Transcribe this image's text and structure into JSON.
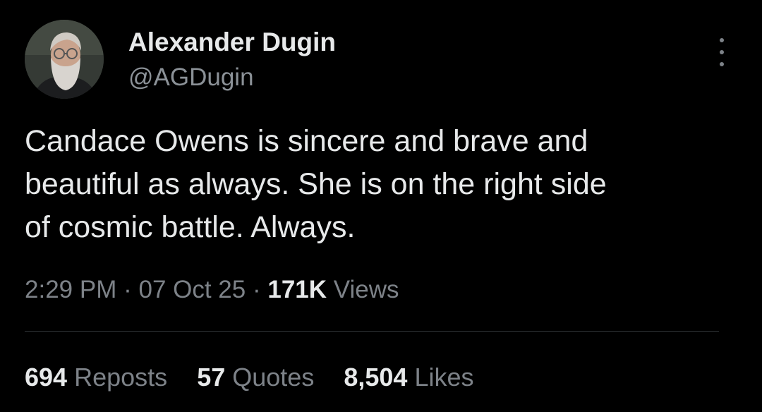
{
  "author": {
    "display_name": "Alexander Dugin",
    "handle": "@AGDugin",
    "avatar_icon": "user-avatar-photo"
  },
  "tweet": {
    "text_lines": [
      "Candace Owens is sincere and brave and",
      "beautiful as always. She is on the right side",
      "of cosmic battle. Always."
    ]
  },
  "meta": {
    "time": "2:29 PM",
    "separator": "·",
    "date": "07 Oct 25",
    "views_count": "171K",
    "views_label": "Views"
  },
  "stats": {
    "reposts_count": "694",
    "reposts_label": "Reposts",
    "quotes_count": "57",
    "quotes_label": "Quotes",
    "likes_count": "8,504",
    "likes_label": "Likes"
  },
  "colors": {
    "background": "#000000",
    "primary_text": "#e7e9ea",
    "secondary_text": "#7d8288",
    "divider": "#2f3336"
  },
  "icons": {
    "more": "more-options-icon"
  }
}
